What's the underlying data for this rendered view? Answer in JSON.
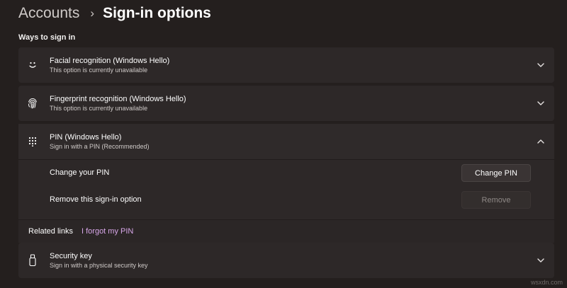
{
  "breadcrumb": {
    "parent": "Accounts",
    "separator": "›",
    "title": "Sign-in options"
  },
  "section_label": "Ways to sign in",
  "options": {
    "facial": {
      "title": "Facial recognition (Windows Hello)",
      "subtitle": "This option is currently unavailable",
      "icon": "smile-face-icon",
      "expanded": false
    },
    "fingerprint": {
      "title": "Fingerprint recognition (Windows Hello)",
      "subtitle": "This option is currently unavailable",
      "icon": "fingerprint-icon",
      "expanded": false
    },
    "pin": {
      "title": "PIN (Windows Hello)",
      "subtitle": "Sign in with a PIN (Recommended)",
      "icon": "keypad-icon",
      "expanded": true,
      "change_label": "Change your PIN",
      "change_button": "Change PIN",
      "remove_label": "Remove this sign-in option",
      "remove_button": "Remove",
      "related_label": "Related links",
      "related_link": "I forgot my PIN"
    },
    "security_key": {
      "title": "Security key",
      "subtitle": "Sign in with a physical security key",
      "icon": "usb-key-icon",
      "expanded": false
    }
  },
  "colors": {
    "background": "#241f1e",
    "card": "#2d2828",
    "link": "#d7a6e8"
  },
  "watermark": "wsxdn.com"
}
